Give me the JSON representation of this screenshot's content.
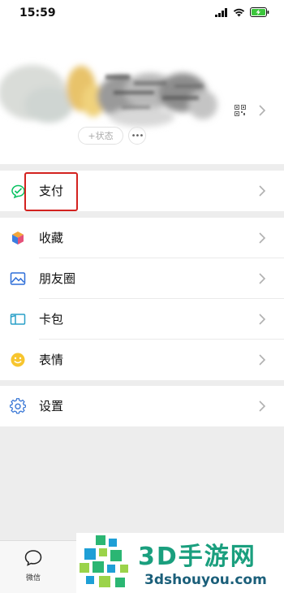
{
  "status_bar": {
    "time": "15:59"
  },
  "profile": {
    "status_text": "+状态",
    "more_text": "•••"
  },
  "menu": {
    "pay": {
      "label": "支付",
      "icon": "wechat-pay-icon"
    },
    "items": [
      {
        "label": "收藏",
        "icon": "favorites-cube-icon"
      },
      {
        "label": "朋友圈",
        "icon": "moments-picture-icon"
      },
      {
        "label": "卡包",
        "icon": "card-wallet-icon"
      },
      {
        "label": "表情",
        "icon": "sticker-smile-icon"
      }
    ],
    "settings": {
      "label": "设置",
      "icon": "settings-gear-icon"
    }
  },
  "tab_bar": {
    "chats_label": "微信"
  },
  "watermark": {
    "title": "3D手游网",
    "url": "3dshouyou.com"
  },
  "colors": {
    "accent_green": "#07c160",
    "highlight_red": "#d3221f"
  }
}
